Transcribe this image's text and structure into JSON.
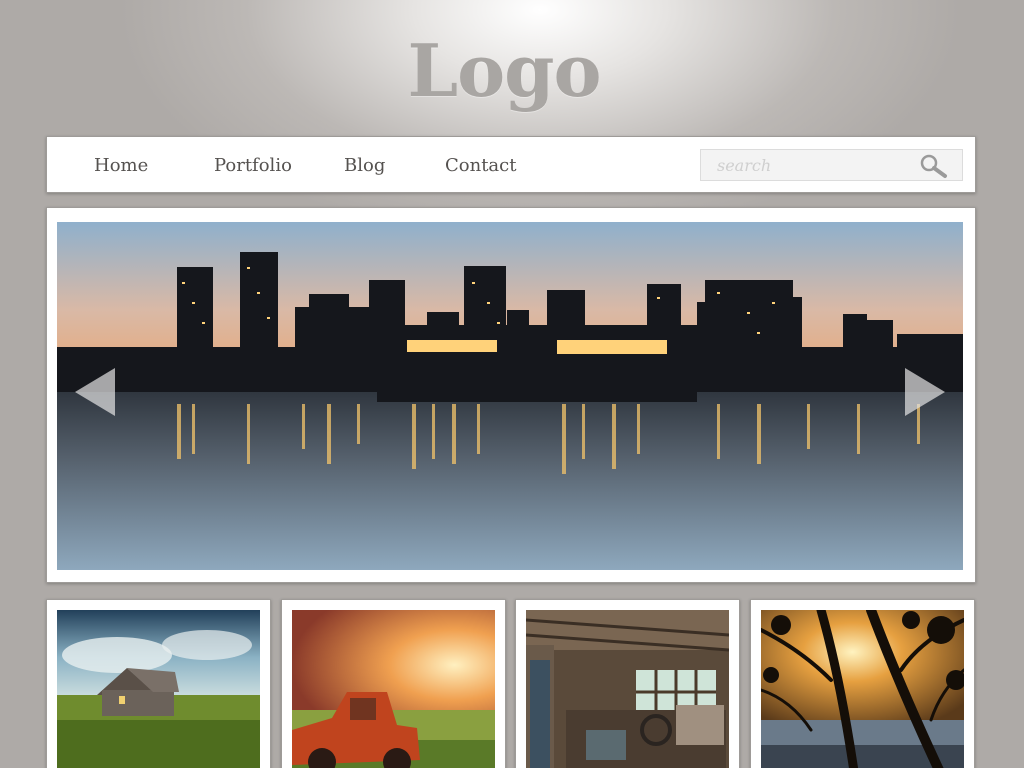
{
  "header": {
    "logo_text": "Logo"
  },
  "nav": {
    "items": [
      {
        "label": "Home"
      },
      {
        "label": "Portfolio"
      },
      {
        "label": "Blog"
      },
      {
        "label": "Contact"
      }
    ]
  },
  "search": {
    "placeholder": "search",
    "value": "",
    "icon": "search-icon"
  },
  "slider": {
    "image": "city-skyline-night-reflection",
    "prev_icon": "chevron-left-icon",
    "next_icon": "chevron-right-icon"
  },
  "thumbnails": [
    {
      "image": "farmhouse-in-grass-field"
    },
    {
      "image": "rusty-red-truck-sunset"
    },
    {
      "image": "cluttered-workshop-interior"
    },
    {
      "image": "tree-silhouette-sunset-lake"
    }
  ],
  "colors": {
    "background": "#aeaaa7",
    "logo": "#a9a6a3",
    "nav_text": "#555250",
    "panel": "#ffffff"
  }
}
